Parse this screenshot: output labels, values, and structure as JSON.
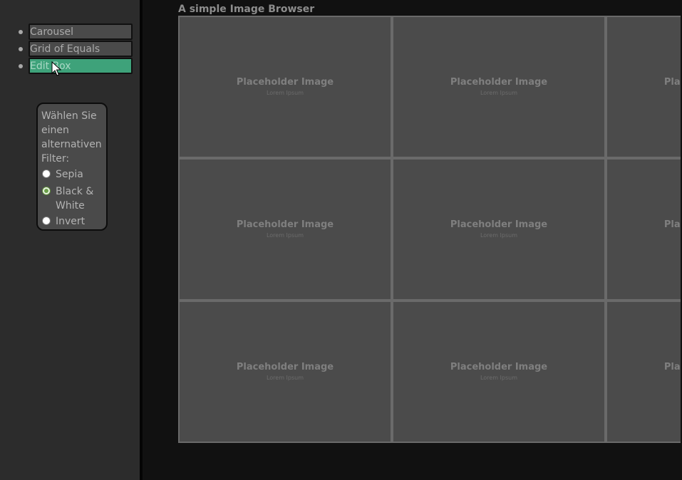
{
  "nav": {
    "items": [
      {
        "label": "Carousel",
        "active": false
      },
      {
        "label": "Grid of Equals",
        "active": false
      },
      {
        "label": "Edit Box",
        "active": true
      }
    ]
  },
  "filter": {
    "prompt": "Wählen Sie einen alternativen Filter:",
    "options": [
      {
        "label": "Sepia",
        "checked": false
      },
      {
        "label": "Black & White",
        "checked": true
      },
      {
        "label": "Invert",
        "checked": false
      }
    ]
  },
  "main": {
    "title": "A simple Image Browser"
  },
  "gallery": {
    "placeholder_title": "Placeholder Image",
    "placeholder_subtitle": "Lorem Ipsum",
    "rows": 3,
    "columns": 3
  },
  "colors": {
    "accent": "#3ea27a",
    "sidebar_bg": "#2c2c2c",
    "page_bg": "#111111",
    "tile_bg": "#4b4b4b"
  }
}
